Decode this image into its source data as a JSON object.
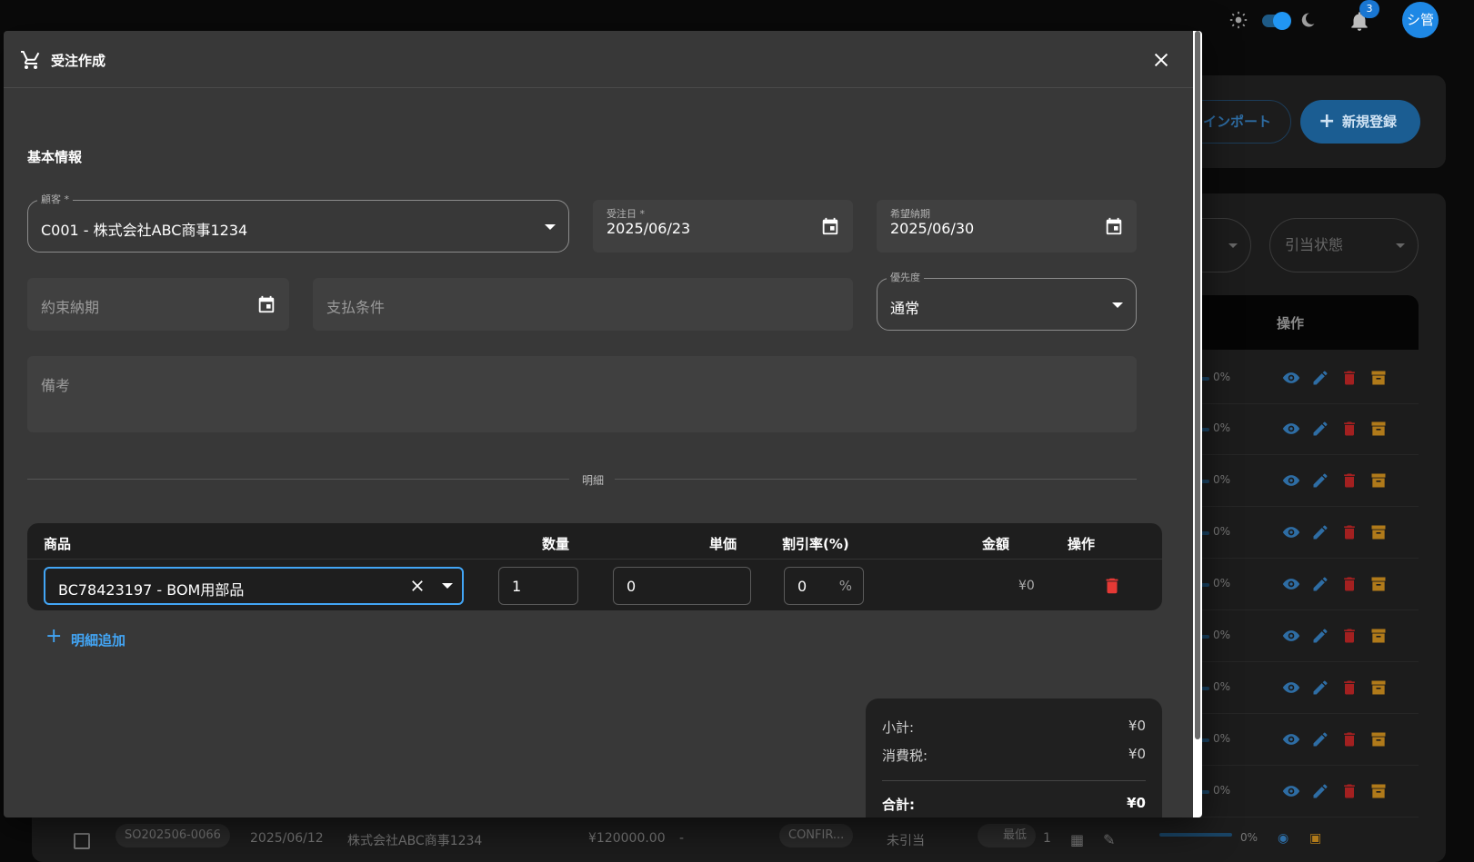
{
  "topbar": {
    "notification_count": "3",
    "avatar_initials": "シ管",
    "icons": [
      "sun-icon",
      "theme-toggle",
      "moon-icon",
      "bell-icon"
    ]
  },
  "background": {
    "import_label": "インポート",
    "new_label": "新規登録",
    "filter_allocation_placeholder": "引当状態",
    "table_header_ops": "操作",
    "row_progress": "0%",
    "last_row": {
      "order_no": "SO202506-0066",
      "date": "2025/06/12",
      "customer": "株式会社ABC商事1234",
      "total": "¥120000.00",
      "dash": "-",
      "status": "CONFIR...",
      "allocation": "未引当",
      "priority": "最低",
      "count": "1",
      "progress": "0%"
    },
    "colors": {
      "view": "#2e6da4",
      "edit": "#2e6da4",
      "delete": "#a32020",
      "archive": "#b07a1a"
    }
  },
  "modal": {
    "title": "受注作成",
    "section_basic": "基本情報",
    "customer": {
      "label": "顧客 *",
      "value": "C001 - 株式会社ABC商事1234"
    },
    "order_date": {
      "label": "受注日 *",
      "value": "2025/06/23"
    },
    "desired_delivery": {
      "label": "希望納期",
      "value": "2025/06/30"
    },
    "promised_delivery": {
      "placeholder": "約束納期"
    },
    "payment_terms": {
      "placeholder": "支払条件"
    },
    "priority": {
      "label": "優先度",
      "value": "通常"
    },
    "notes": {
      "placeholder": "備考"
    },
    "details_divider": "明細",
    "items": {
      "headers": {
        "product": "商品",
        "quantity": "数量",
        "unit_price": "単価",
        "discount": "割引率(%)",
        "amount": "金額",
        "ops": "操作"
      },
      "rows": [
        {
          "product": "BC78423197 - BOM用部品",
          "quantity": "1",
          "unit_price": "0",
          "discount": "0",
          "discount_suffix": "%",
          "amount": "¥0"
        }
      ]
    },
    "add_line_label": "明細追加",
    "summary": {
      "subtotal_label": "小計:",
      "subtotal": "¥0",
      "tax_label": "消費税:",
      "tax": "¥0",
      "total_label": "合計:",
      "total": "¥0"
    },
    "accent_color": "#42a5f5",
    "delete_color": "#e53935"
  }
}
